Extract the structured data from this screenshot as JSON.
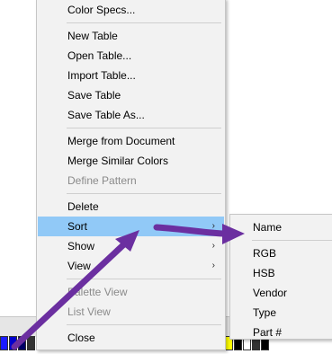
{
  "menu": {
    "items": [
      {
        "label": "Color Specs...",
        "state": "normal"
      },
      {
        "label": "New Table",
        "state": "normal"
      },
      {
        "label": "Open Table...",
        "state": "normal"
      },
      {
        "label": "Import Table...",
        "state": "normal"
      },
      {
        "label": "Save Table",
        "state": "normal"
      },
      {
        "label": "Save Table As...",
        "state": "normal"
      },
      {
        "label": "Merge from Document",
        "state": "normal"
      },
      {
        "label": "Merge Similar Colors",
        "state": "normal"
      },
      {
        "label": "Define Pattern",
        "state": "disabled"
      },
      {
        "label": "Delete",
        "state": "normal"
      },
      {
        "label": "Sort",
        "state": "highlighted",
        "has_submenu": true
      },
      {
        "label": "Show",
        "state": "normal",
        "has_submenu": true
      },
      {
        "label": "View",
        "state": "normal",
        "has_submenu": true
      },
      {
        "label": "Palette View",
        "state": "disabled"
      },
      {
        "label": "List View",
        "state": "disabled"
      },
      {
        "label": "Close",
        "state": "normal"
      }
    ],
    "submenu_arrow": "›"
  },
  "submenu": {
    "items": [
      {
        "label": "Name"
      },
      {
        "label": "RGB"
      },
      {
        "label": "HSB"
      },
      {
        "label": "Vendor"
      },
      {
        "label": "Type"
      },
      {
        "label": "Part #"
      }
    ]
  },
  "colors": {
    "menu_bg": "#f2f2f2",
    "highlight": "#91c9f7",
    "disabled_text": "#8a8a8a",
    "annotation_arrow": "#6b2fa0"
  },
  "palette": [
    "#1a1aff",
    "#0000cc",
    "#000066",
    "#333333",
    "#f2f2f2",
    "#c0c0c0",
    "#ffffff",
    "#d0d0d0",
    "#bbbbbb",
    "#999999",
    "#cccccc",
    "#eeeeee",
    "#aaaaaa",
    "#dddddd",
    "#f0f0f0",
    "#b0b0b0",
    "#e0e0e0",
    "#ffffff",
    "#c8c8c8",
    "#a0a0a0",
    "#000000",
    "#3333cc",
    "#ffffff",
    "#cc0000",
    "#ffffff",
    "#ffff00",
    "#000000",
    "#ffffff",
    "#333333",
    "#000000"
  ]
}
